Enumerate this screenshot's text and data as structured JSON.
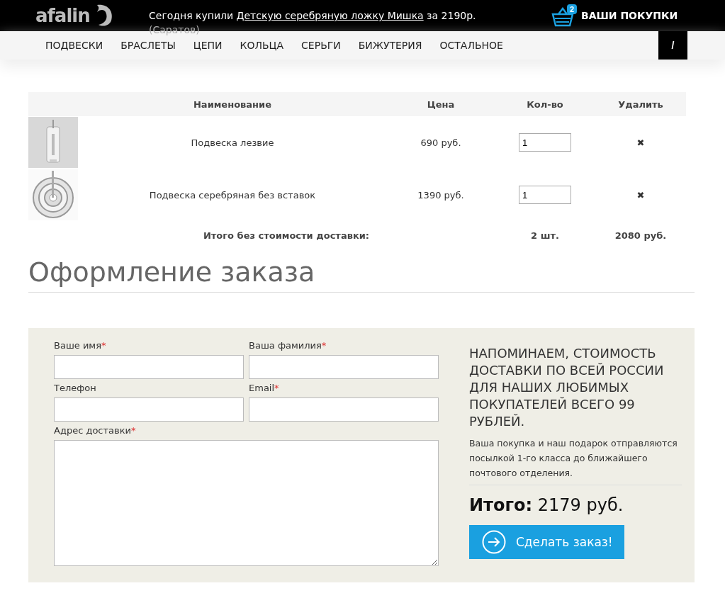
{
  "header": {
    "logo": "afalin",
    "ticker": {
      "before": "Сегодня купили ",
      "link": "Детскую серебряную ложку Мишка",
      "after": " за 2190р.",
      "city": "(Саратов)"
    },
    "cart_count": "2",
    "cart_label": "ВАШИ ПОКУПКИ"
  },
  "nav": {
    "items": [
      "ПОДВЕСКИ",
      "БРАСЛЕТЫ",
      "ЦЕПИ",
      "КОЛЬЦА",
      "СЕРЬГИ",
      "БИЖУТЕРИЯ",
      "ОСТАЛЬНОЕ"
    ],
    "side_button": "/"
  },
  "cart": {
    "columns": [
      "Наименование",
      "Цена",
      "Кол-во",
      "Удалить"
    ],
    "rows": [
      {
        "name": "Подвеска лезвие",
        "price": "690 руб.",
        "qty": "1",
        "remove": "✖"
      },
      {
        "name": "Подвеска серебряная без вставок",
        "price": "1390 руб.",
        "qty": "1",
        "remove": "✖"
      }
    ],
    "total_label": "Итого без стоимости доставки:",
    "total_qty": "2 шт.",
    "total_sum": "2080 руб."
  },
  "checkout": {
    "title": "Оформление заказа",
    "fields": [
      {
        "label": "Ваше имя",
        "mark": "*",
        "kind": "input"
      },
      {
        "label": "Ваша фамилия",
        "mark": "*",
        "kind": "input"
      },
      {
        "label": "Телефон",
        "kind": "input"
      },
      {
        "label": "Email",
        "mark": "*",
        "kind": "input"
      },
      {
        "label": "Адрес доставки",
        "mark": "*",
        "kind": "textarea"
      }
    ],
    "notice_title": "НАПОМИНАЕМ, СТОИМОСТЬ ДОСТАВКИ ПО ВСЕЙ РОССИИ ДЛЯ НАШИХ ЛЮБИМЫХ ПОКУПАТЕЛЕЙ ВСЕГО 99 РУБЛЕЙ.",
    "notice_text": "Ваша покупка и наш подарок отправляются посылкой 1-го класса до ближайшего почтового отделения.",
    "total": "**Итого:** 2179 руб.",
    "submit": "Сделать заказ!"
  }
}
